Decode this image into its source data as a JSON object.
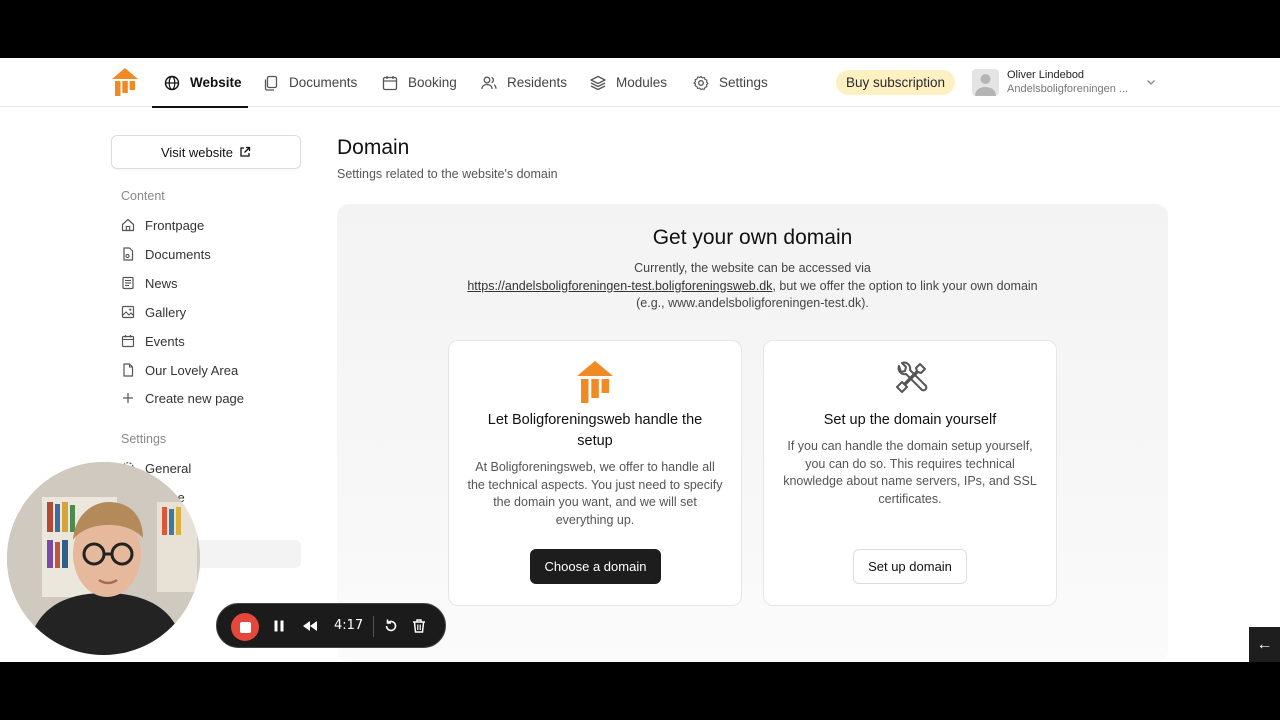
{
  "nav": {
    "items": [
      {
        "label": "Website",
        "icon": "globe-icon"
      },
      {
        "label": "Documents",
        "icon": "documents-icon"
      },
      {
        "label": "Booking",
        "icon": "calendar-icon"
      },
      {
        "label": "Residents",
        "icon": "users-icon"
      },
      {
        "label": "Modules",
        "icon": "layers-icon"
      },
      {
        "label": "Settings",
        "icon": "gear-icon"
      }
    ],
    "active": "Website",
    "buy_label": "Buy subscription",
    "user_name": "Oliver Lindebod",
    "user_org": "Andelsboligforeningen ..."
  },
  "sidebar": {
    "visit_label": "Visit website",
    "content_heading": "Content",
    "content_items": [
      {
        "label": "Frontpage",
        "icon": "home-icon"
      },
      {
        "label": "Documents",
        "icon": "document-icon"
      },
      {
        "label": "News",
        "icon": "news-icon"
      },
      {
        "label": "Gallery",
        "icon": "gallery-icon"
      },
      {
        "label": "Events",
        "icon": "calendar-icon"
      },
      {
        "label": "Our Lovely Area",
        "icon": "page-icon"
      },
      {
        "label": "Create new page",
        "icon": "plus-icon"
      }
    ],
    "settings_heading": "Settings",
    "settings_items": [
      {
        "label": "General",
        "icon": "gear-icon"
      },
      {
        "label": "arance",
        "icon": "palette-icon"
      }
    ]
  },
  "main": {
    "title": "Domain",
    "subtitle": "Settings related to the website's domain",
    "panel_title": "Get your own domain",
    "desc_before": "Currently, the website can be accessed via",
    "desc_link": "https://andelsboligforeningen-test.boligforeningsweb.dk",
    "desc_after": ", but we offer the option to link your own domain (e.g., www.andelsboligforeningen-test.dk).",
    "card1": {
      "title": "Let Boligforeningsweb handle the setup",
      "text": "At Boligforeningsweb, we offer to handle all the technical aspects. You just need to specify the domain you want, and we will set everything up.",
      "button": "Choose a domain"
    },
    "card2": {
      "title": "Set up the domain yourself",
      "text": "If you can handle the domain setup yourself, you can do so. This requires technical knowledge about name servers, IPs, and SSL certificates.",
      "button": "Set up domain"
    }
  },
  "recorder": {
    "time": "4:17"
  },
  "colors": {
    "brand_orange": "#f08a24",
    "buy_bg": "#fdf0c2",
    "dark_button": "#1d1d1d",
    "stop_red": "#e5483a"
  }
}
